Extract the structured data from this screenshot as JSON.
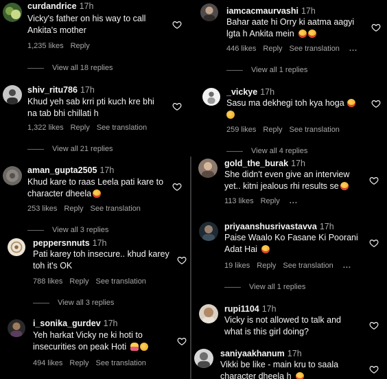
{
  "left": [
    {
      "user": "curdandrice",
      "time": "17h",
      "line1": "Vicky's father on his way to call",
      "line2": "Ankita's mother",
      "likes": "1,235 likes",
      "reply": "Reply",
      "see_translation": "",
      "view_replies": "View all 18 replies"
    },
    {
      "user": "shiv_ritu786",
      "time": "17h",
      "line1": "Khud yeh sab krri pti kuch kre bhi",
      "line2": "na tab bhi chillati h",
      "likes": "1,322 likes",
      "reply": "Reply",
      "see_translation": "See translation",
      "view_replies": "View all 21 replies"
    },
    {
      "user": "aman_gupta2505",
      "time": "17h",
      "line1": "Khud kare to raas Leela pati kare to",
      "line2": "character dheela",
      "likes": "253 likes",
      "reply": "Reply",
      "see_translation": "See translation",
      "view_replies": "View all 3 replies"
    },
    {
      "user": "peppersnnuts",
      "time": "17h",
      "line1": "Pati karey toh insecure.. khud karey",
      "line2": "toh it's OK",
      "likes": "788 likes",
      "reply": "Reply",
      "see_translation": "See translation",
      "view_replies": "View all 3 replies"
    },
    {
      "user": "i_sonika_gurdev",
      "time": "17h",
      "line1": "Yeh harkat Vicky ne ki hoti to",
      "line2": "insecurities on peak Hoti",
      "likes": "494 likes",
      "reply": "Reply",
      "see_translation": "See translation",
      "view_replies": ""
    }
  ],
  "right": [
    {
      "user": "iamcacmaurvashi",
      "time": "17h",
      "line1": "Bahar aate hi Orry ki aatma aagyi",
      "line2": "lgta h Ankita mein",
      "likes": "446 likes",
      "reply": "Reply",
      "see_translation": "See translation",
      "more": "...",
      "view_replies": "View all 1 replies"
    },
    {
      "user": "_vickye",
      "time": "17h",
      "line1": "Sasu ma dekhegi toh kya hoga",
      "line2": "",
      "likes": "259 likes",
      "reply": "Reply",
      "see_translation": "See translation",
      "more": "",
      "view_replies": "View all 4 replies"
    },
    {
      "user": "gold_the_burak",
      "time": "17h",
      "line1": "She didn't even give an interview",
      "line2": "yet.. kitni jealous rhi results se",
      "likes": "113 likes",
      "reply": "Reply",
      "see_translation": "",
      "more": "...",
      "view_replies": ""
    },
    {
      "user": "priyaanshusrivastavva",
      "time": "17h",
      "line1": "Paise Waalo Ko Fasane Ki Poorani",
      "line2": "Adat Hai",
      "likes": "19 likes",
      "reply": "Reply",
      "see_translation": "See translation",
      "more": "...",
      "view_replies": "View all 1 replies"
    },
    {
      "user": "rupi1104",
      "time": "17h",
      "line1": "Vicky is not allowed to talk and",
      "line2": "what is this girl doing?",
      "likes": "",
      "reply": "",
      "see_translation": "",
      "more": "",
      "view_replies": ""
    },
    {
      "user": "saniyaakhanum",
      "time": "17h",
      "line1": "Vikki be like - main kru to saala",
      "line2": "character dheela h",
      "likes": "",
      "reply": "",
      "see_translation": "",
      "more": "",
      "view_replies": ""
    }
  ],
  "colors": {
    "background": "#000000",
    "text": "#f5f5f5",
    "muted": "#a8a8a8",
    "divider": "#3a3a3a"
  },
  "icons": {
    "like": "heart-outline-icon",
    "more": "more-dots-icon"
  }
}
